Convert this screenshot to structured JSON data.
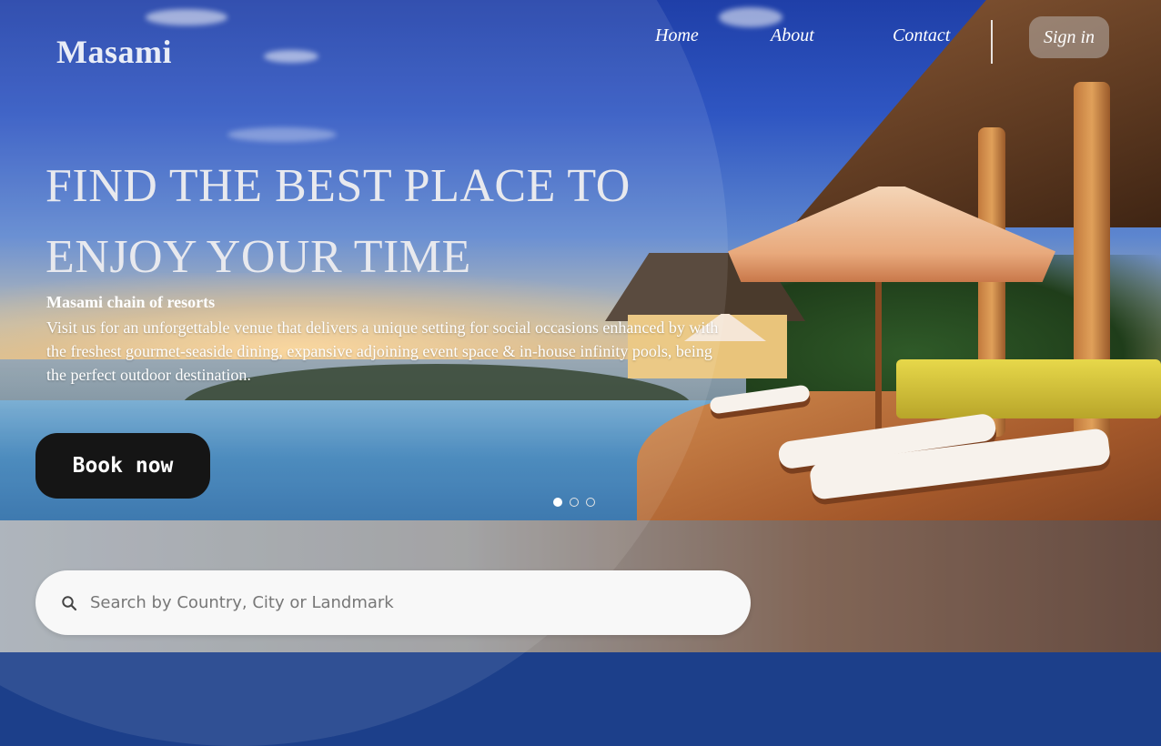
{
  "brand": {
    "name": "Masami"
  },
  "nav": {
    "items": [
      {
        "label": "Home"
      },
      {
        "label": "About"
      },
      {
        "label": "Contact"
      }
    ],
    "sign_in_label": "Sign in"
  },
  "hero": {
    "title_line1": "FIND THE BEST PLACE TO",
    "title_line2": "ENJOY YOUR TIME",
    "subtitle": "Masami chain of resorts",
    "description": "Visit us for an unforgettable venue that delivers a unique setting for social occasions enhanced by with the freshest gourmet-seaside dining, expansive adjoining event space & in-house infinity pools, being the perfect outdoor destination.",
    "cta_label": "Book now",
    "carousel": {
      "count": 3,
      "active_index": 0
    }
  },
  "search": {
    "placeholder": "Search by Country, City or Landmark",
    "value": ""
  },
  "icons": {
    "search": "search-icon"
  }
}
